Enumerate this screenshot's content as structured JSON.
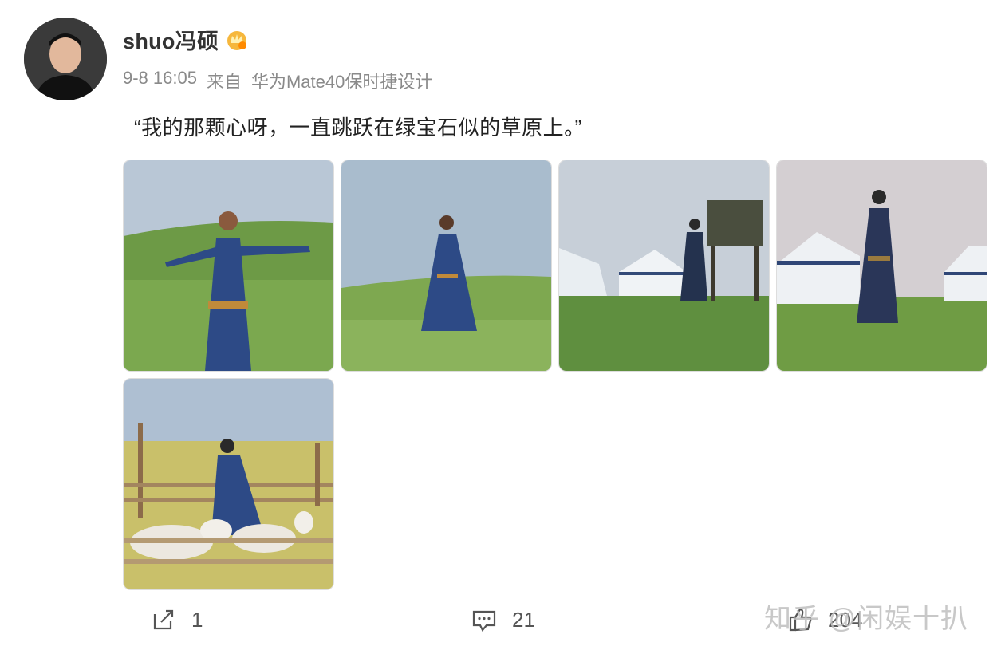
{
  "post": {
    "username": "shuo冯硕",
    "time": "9-8 16:05",
    "source_prefix": "来自",
    "source_device": "华为Mate40保时捷设计",
    "text": "“我的那颗心呀，一直跳跃在绿宝石似的草原上。”",
    "photo_count": 5
  },
  "actions": {
    "repost_count": "1",
    "comment_count": "21",
    "like_count": "204"
  },
  "watermark": {
    "text": "知乎 @闲娱十扒"
  },
  "colors": {
    "sky": "#b9c7d6",
    "grass": "#6d9a46",
    "robe": "#2d4a86",
    "text_meta": "#8a8a8a"
  }
}
